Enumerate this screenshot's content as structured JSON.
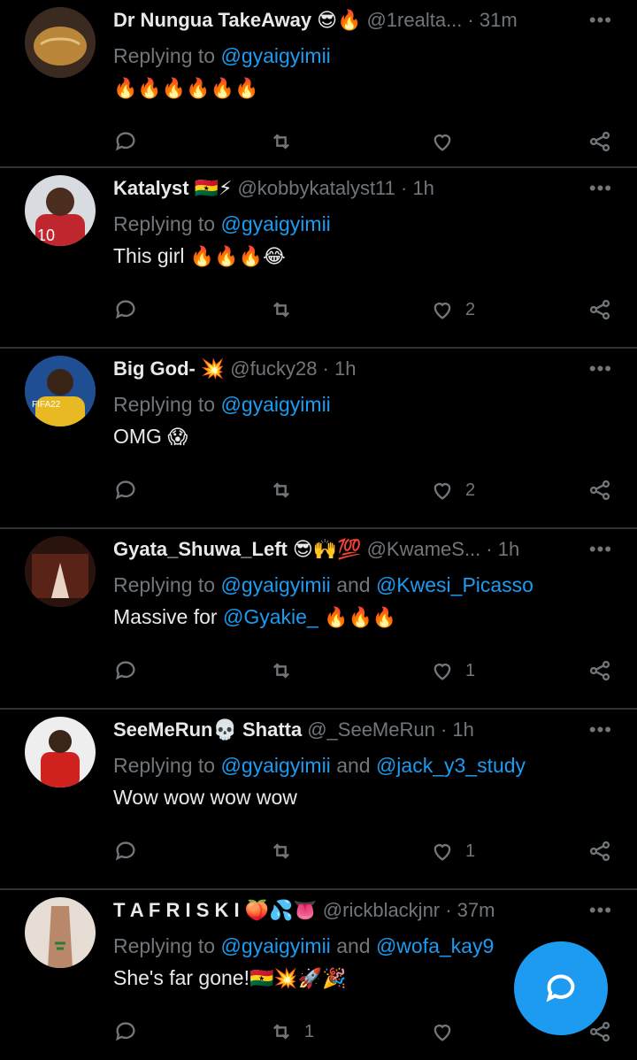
{
  "tweets": [
    {
      "name": "Dr Nungua TakeAway",
      "name_emoji": "😎🔥",
      "handle": "@1realta...",
      "time": "· 31m",
      "reply_prefix": "Replying to",
      "reply_mentions": "@gyaigyimii",
      "reply_and": "",
      "reply_mentions2": "",
      "text": "",
      "text_mention": "",
      "text_emoji": "🔥🔥🔥🔥🔥🔥",
      "retweets": "",
      "likes": "",
      "avatar_color": "#6b4a2f"
    },
    {
      "name": "Katalyst",
      "name_emoji": "🇬🇭⚡",
      "handle": "@kobbykatalyst11 · 1h",
      "time": "",
      "reply_prefix": "Replying to",
      "reply_mentions": "@gyaigyimii",
      "reply_and": "",
      "reply_mentions2": "",
      "text": "This girl ",
      "text_mention": "",
      "text_emoji": "🔥🔥🔥😂",
      "retweets": "",
      "likes": "2",
      "avatar_color": "#c0262d"
    },
    {
      "name": "Big God-",
      "name_emoji": "💥",
      "handle": "@fucky28 · 1h",
      "time": "",
      "reply_prefix": "Replying to",
      "reply_mentions": "@gyaigyimii",
      "reply_and": "",
      "reply_mentions2": "",
      "text": "OMG ",
      "text_mention": "",
      "text_emoji": "😱",
      "retweets": "",
      "likes": "2",
      "avatar_color": "#2a5fa8"
    },
    {
      "name": "Gyata_Shuwa_Left",
      "name_emoji": "😎🙌💯",
      "handle": "@KwameS...",
      "time": "· 1h",
      "reply_prefix": "Replying to",
      "reply_mentions": "@gyaigyimii",
      "reply_and": "and",
      "reply_mentions2": "@Kwesi_Picasso",
      "text": "Massive for ",
      "text_mention": "@Gyakie_",
      "text_emoji": "🔥🔥🔥",
      "retweets": "",
      "likes": "1",
      "avatar_color": "#3a1b14"
    },
    {
      "name": "SeeMeRun💀 Shatta",
      "name_emoji": "💀",
      "handle": "@_SeeMeRun · 1h",
      "time": "",
      "reply_prefix": "Replying to",
      "reply_mentions": "@gyaigyimii",
      "reply_and": "and",
      "reply_mentions2": "@jack_y3_study",
      "text": "Wow wow wow wow",
      "text_mention": "",
      "text_emoji": "",
      "retweets": "",
      "likes": "1",
      "avatar_color": "#e8e6e4"
    },
    {
      "name": "T A F R I S K I",
      "name_emoji": "🍑💦👅",
      "handle": "@rickblackjnr · 37m",
      "time": "",
      "reply_prefix": "Replying to",
      "reply_mentions": "@gyaigyimii",
      "reply_and": "and",
      "reply_mentions2": "@wofa_kay9",
      "text": "She's far gone!",
      "text_mention": "",
      "text_emoji": "🇬🇭💥🚀🎉",
      "retweets": "1",
      "likes": "",
      "avatar_color": "#d9cfc6"
    }
  ],
  "icons": {
    "more": "more-horizontal-icon",
    "reply": "reply-icon",
    "retweet": "retweet-icon",
    "like": "heart-icon",
    "share": "share-icon",
    "compose": "compose-reply-icon"
  },
  "colors": {
    "background": "#000000",
    "accent": "#1d9bf0",
    "muted": "#71767b"
  }
}
